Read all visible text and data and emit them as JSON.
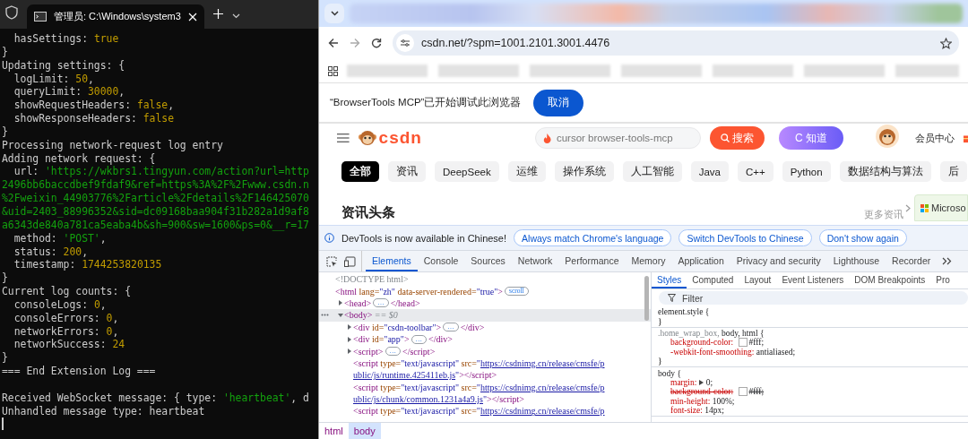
{
  "terminal": {
    "tab_title": "管理员: C:\\Windows\\system3",
    "lines": [
      {
        "kind": "text",
        "segments": [
          {
            "text": "  hasSettings: ",
            "kind": "plain"
          },
          {
            "text": "true",
            "kind": "number"
          }
        ]
      },
      {
        "kind": "text",
        "segments": [
          {
            "text": "}",
            "kind": "plain"
          }
        ]
      },
      {
        "kind": "text",
        "segments": [
          {
            "text": "Updating settings: {",
            "kind": "plain"
          }
        ]
      },
      {
        "kind": "text",
        "segments": [
          {
            "text": "  logLimit: ",
            "kind": "plain"
          },
          {
            "text": "50",
            "kind": "number"
          },
          {
            "text": ",",
            "kind": "plain"
          }
        ]
      },
      {
        "kind": "text",
        "segments": [
          {
            "text": "  queryLimit: ",
            "kind": "plain"
          },
          {
            "text": "30000",
            "kind": "number"
          },
          {
            "text": ",",
            "kind": "plain"
          }
        ]
      },
      {
        "kind": "text",
        "segments": [
          {
            "text": "  showRequestHeaders: ",
            "kind": "plain"
          },
          {
            "text": "false",
            "kind": "number"
          },
          {
            "text": ",",
            "kind": "plain"
          }
        ]
      },
      {
        "kind": "text",
        "segments": [
          {
            "text": "  showResponseHeaders: ",
            "kind": "plain"
          },
          {
            "text": "false",
            "kind": "number"
          }
        ]
      },
      {
        "kind": "text",
        "segments": [
          {
            "text": "}",
            "kind": "plain"
          }
        ]
      },
      {
        "kind": "text",
        "segments": [
          {
            "text": "Processing network-request log entry",
            "kind": "plain"
          }
        ]
      },
      {
        "kind": "text",
        "segments": [
          {
            "text": "Adding network request: {",
            "kind": "plain"
          }
        ]
      },
      {
        "kind": "text",
        "segments": [
          {
            "text": "  url: ",
            "kind": "plain"
          },
          {
            "text": "'https://wkbrs1.tingyun.com/action?url=http",
            "kind": "string"
          }
        ]
      },
      {
        "kind": "text",
        "segments": [
          {
            "text": "2496bb6baccdbef9fdaf9&ref=https%3A%2F%2Fwww.csdn.n",
            "kind": "string"
          }
        ]
      },
      {
        "kind": "text",
        "segments": [
          {
            "text": "%2Fweixin_44903776%2Farticle%2Fdetails%2F146425070",
            "kind": "string"
          }
        ]
      },
      {
        "kind": "text",
        "segments": [
          {
            "text": "&uid=2403_88996352&sid=dc09168baa904f31b282a1d9af8",
            "kind": "string"
          }
        ]
      },
      {
        "kind": "text",
        "segments": [
          {
            "text": "a6343de840a781ca5eaba4b&sh=900&sw=1600&ps=0&__r=17",
            "kind": "string"
          }
        ]
      },
      {
        "kind": "text",
        "segments": [
          {
            "text": "  method: ",
            "kind": "plain"
          },
          {
            "text": "'POST'",
            "kind": "string"
          },
          {
            "text": ",",
            "kind": "plain"
          }
        ]
      },
      {
        "kind": "text",
        "segments": [
          {
            "text": "  status: ",
            "kind": "plain"
          },
          {
            "text": "200",
            "kind": "number"
          },
          {
            "text": ",",
            "kind": "plain"
          }
        ]
      },
      {
        "kind": "text",
        "segments": [
          {
            "text": "  timestamp: ",
            "kind": "plain"
          },
          {
            "text": "1744253820135",
            "kind": "number"
          }
        ]
      },
      {
        "kind": "text",
        "segments": [
          {
            "text": "}",
            "kind": "plain"
          }
        ]
      },
      {
        "kind": "text",
        "segments": [
          {
            "text": "Current log counts: {",
            "kind": "plain"
          }
        ]
      },
      {
        "kind": "text",
        "segments": [
          {
            "text": "  consoleLogs: ",
            "kind": "plain"
          },
          {
            "text": "0",
            "kind": "number"
          },
          {
            "text": ",",
            "kind": "plain"
          }
        ]
      },
      {
        "kind": "text",
        "segments": [
          {
            "text": "  consoleErrors: ",
            "kind": "plain"
          },
          {
            "text": "0",
            "kind": "number"
          },
          {
            "text": ",",
            "kind": "plain"
          }
        ]
      },
      {
        "kind": "text",
        "segments": [
          {
            "text": "  networkErrors: ",
            "kind": "plain"
          },
          {
            "text": "0",
            "kind": "number"
          },
          {
            "text": ",",
            "kind": "plain"
          }
        ]
      },
      {
        "kind": "text",
        "segments": [
          {
            "text": "  networkSuccess: ",
            "kind": "plain"
          },
          {
            "text": "24",
            "kind": "number"
          }
        ]
      },
      {
        "kind": "text",
        "segments": [
          {
            "text": "}",
            "kind": "plain"
          }
        ]
      },
      {
        "kind": "text",
        "segments": [
          {
            "text": "=== End Extension Log ===",
            "kind": "plain"
          }
        ]
      },
      {
        "kind": "blank"
      },
      {
        "kind": "text",
        "segments": [
          {
            "text": "Received WebSocket message: { type: ",
            "kind": "plain"
          },
          {
            "text": "'heartbeat'",
            "kind": "string"
          },
          {
            "text": ", d",
            "kind": "plain"
          }
        ]
      },
      {
        "kind": "text",
        "segments": [
          {
            "text": "Unhandled message type: heartbeat",
            "kind": "plain"
          }
        ]
      }
    ]
  },
  "browser": {
    "url": "csdn.net/?spm=1001.2101.3001.4476",
    "infobar": {
      "message": "“BrowserTools MCP”已开始调试此浏览器",
      "button": "取消"
    },
    "page": {
      "logo": "csdn",
      "search": {
        "placeholder": "cursor browser-tools-mcp",
        "button": "搜索"
      },
      "ai_button": "C 知道",
      "member": "会员中心",
      "categories": [
        {
          "label": "全部",
          "selected": true
        },
        {
          "label": "资讯",
          "selected": false
        },
        {
          "label": "DeepSeek",
          "selected": false
        },
        {
          "label": "运维",
          "selected": false
        },
        {
          "label": "操作系统",
          "selected": false
        },
        {
          "label": "人工智能",
          "selected": false
        },
        {
          "label": "Java",
          "selected": false
        },
        {
          "label": "C++",
          "selected": false
        },
        {
          "label": "Python",
          "selected": false
        },
        {
          "label": "数据结构与算法",
          "selected": false
        },
        {
          "label": "后",
          "selected": false
        }
      ],
      "section_title": "资讯头条",
      "more": "更多资讯",
      "ad": "Microso"
    }
  },
  "devtools": {
    "banner": {
      "message": "DevTools is now available in Chinese!",
      "buttons": [
        "Always match Chrome's language",
        "Switch DevTools to Chinese",
        "Don't show again"
      ]
    },
    "tabs": [
      {
        "label": "Elements",
        "selected": true
      },
      {
        "label": "Console",
        "selected": false
      },
      {
        "label": "Sources",
        "selected": false
      },
      {
        "label": "Network",
        "selected": false
      },
      {
        "label": "Performance",
        "selected": false
      },
      {
        "label": "Memory",
        "selected": false
      },
      {
        "label": "Application",
        "selected": false
      },
      {
        "label": "Privacy and security",
        "selected": false
      },
      {
        "label": "Lighthouse",
        "selected": false
      },
      {
        "label": "Recorder",
        "selected": false
      }
    ],
    "dom": [
      {
        "selected": false,
        "segments": [
          {
            "kind": "doctype",
            "text": "<!DOCTYPE html>"
          }
        ]
      },
      {
        "selected": false,
        "segments": [
          {
            "kind": "tag",
            "text": "<html"
          },
          {
            "kind": "attr",
            "text": " lang="
          },
          {
            "kind": "value",
            "text": "\"zh\""
          },
          {
            "kind": "attr",
            "text": " data-server-rendered="
          },
          {
            "kind": "value",
            "text": "\"true\""
          },
          {
            "kind": "tag",
            "text": ">"
          },
          {
            "kind": "badge",
            "text": "scroll"
          }
        ],
        "children": [
          {
            "selected": false,
            "expanded": false,
            "segments": [
              {
                "kind": "tag",
                "text": "<head>"
              },
              {
                "kind": "ellipsis",
                "text": "…"
              },
              {
                "kind": "tag",
                "text": "</head>"
              }
            ]
          },
          {
            "selected": true,
            "expanded": true,
            "segments": [
              {
                "kind": "tag",
                "text": "<body>"
              },
              {
                "kind": "ref",
                "text": " == $0"
              }
            ],
            "children": [
              {
                "selected": false,
                "expanded": false,
                "segments": [
                  {
                    "kind": "tag",
                    "text": "<div"
                  },
                  {
                    "kind": "attr",
                    "text": " id="
                  },
                  {
                    "kind": "value",
                    "text": "\"csdn-toolbar\""
                  },
                  {
                    "kind": "tag",
                    "text": ">"
                  },
                  {
                    "kind": "ellipsis",
                    "text": "…"
                  },
                  {
                    "kind": "tag",
                    "text": "</div>"
                  }
                ]
              },
              {
                "selected": false,
                "expanded": false,
                "segments": [
                  {
                    "kind": "tag",
                    "text": "<div"
                  },
                  {
                    "kind": "attr",
                    "text": " id="
                  },
                  {
                    "kind": "value",
                    "text": "\"app\""
                  },
                  {
                    "kind": "tag",
                    "text": ">"
                  },
                  {
                    "kind": "ellipsis",
                    "text": "…"
                  },
                  {
                    "kind": "tag",
                    "text": "</div>"
                  }
                ]
              },
              {
                "selected": false,
                "expanded": false,
                "segments": [
                  {
                    "kind": "tag",
                    "text": "<script>"
                  },
                  {
                    "kind": "ellipsis",
                    "text": "…"
                  },
                  {
                    "kind": "tag",
                    "text": "</script>"
                  }
                ]
              },
              {
                "selected": false,
                "segments": [
                  {
                    "kind": "tag",
                    "text": "<script"
                  },
                  {
                    "kind": "attr",
                    "text": " type="
                  },
                  {
                    "kind": "value",
                    "text": "\"text/javascript\""
                  },
                  {
                    "kind": "attr",
                    "text": " src="
                  },
                  {
                    "kind": "value",
                    "text": "\""
                  },
                  {
                    "kind": "link",
                    "text": "https://csdnimg.cn/release/cmsfe/p"
                  }
                ],
                "wrap": [
                  {
                    "kind": "link",
                    "text": "ublic/js/runtime.425411eb.js"
                  },
                  {
                    "kind": "value",
                    "text": "\""
                  },
                  {
                    "kind": "tag",
                    "text": "></script>"
                  }
                ]
              },
              {
                "selected": false,
                "segments": [
                  {
                    "kind": "tag",
                    "text": "<script"
                  },
                  {
                    "kind": "attr",
                    "text": " type="
                  },
                  {
                    "kind": "value",
                    "text": "\"text/javascript\""
                  },
                  {
                    "kind": "attr",
                    "text": " src="
                  },
                  {
                    "kind": "value",
                    "text": "\""
                  },
                  {
                    "kind": "link",
                    "text": "https://csdnimg.cn/release/cmsfe/p"
                  }
                ],
                "wrap": [
                  {
                    "kind": "link",
                    "text": "ublic/js/chunk/common.1231a4a9.js"
                  },
                  {
                    "kind": "value",
                    "text": "\""
                  },
                  {
                    "kind": "tag",
                    "text": "></script>"
                  }
                ]
              },
              {
                "selected": false,
                "segments": [
                  {
                    "kind": "tag",
                    "text": "<script"
                  },
                  {
                    "kind": "attr",
                    "text": " type="
                  },
                  {
                    "kind": "value",
                    "text": "\"text/javascript\""
                  },
                  {
                    "kind": "attr",
                    "text": " src="
                  },
                  {
                    "kind": "value",
                    "text": "\""
                  },
                  {
                    "kind": "link",
                    "text": "https://csdnimg.cn/release/cmsfe/p"
                  }
                ]
              }
            ]
          }
        ]
      }
    ],
    "styles": {
      "tabs": [
        {
          "label": "Styles",
          "selected": true
        },
        {
          "label": "Computed",
          "selected": false
        },
        {
          "label": "Layout",
          "selected": false
        },
        {
          "label": "Event Listeners",
          "selected": false
        },
        {
          "label": "DOM Breakpoints",
          "selected": false
        },
        {
          "label": "Pro",
          "selected": false
        }
      ],
      "filter_placeholder": "Filter",
      "rules": [
        {
          "selector": [
            {
              "text": "element.style {",
              "matched": true
            }
          ],
          "close": "}"
        },
        {
          "selector": [
            {
              "text": ".home_wrap_box, ",
              "matched": false
            },
            {
              "text": "body, html {",
              "matched": true
            }
          ],
          "declarations": [
            {
              "property": "background-color:",
              "value": "#fff;",
              "swatch": true,
              "struck": false,
              "expandable": false
            },
            {
              "property": "-webkit-font-smoothing:",
              "value": "antialiased;",
              "struck": false,
              "expandable": false
            }
          ],
          "close": "}"
        },
        {
          "selector": [
            {
              "text": "body {",
              "matched": true
            }
          ],
          "declarations": [
            {
              "property": "margin:",
              "value": "0;",
              "struck": false,
              "expandable": true
            },
            {
              "property": "background-color:",
              "value": "#fff;",
              "swatch": true,
              "struck": true,
              "expandable": false
            },
            {
              "property": "min-height:",
              "value": "100%;",
              "struck": false,
              "expandable": false
            },
            {
              "property": "font-size:",
              "value": "14px;",
              "struck": false,
              "expandable": false
            }
          ]
        }
      ]
    },
    "breadcrumbs": [
      {
        "label": "html",
        "selected": false
      },
      {
        "label": "body",
        "selected": true
      }
    ]
  }
}
